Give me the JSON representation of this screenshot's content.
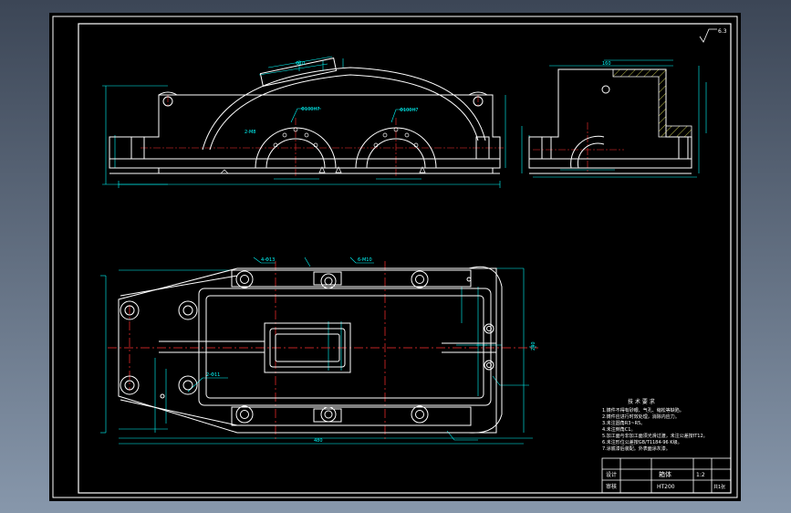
{
  "colors": {
    "background_top": "#3c4656",
    "background_bottom": "#8797ab",
    "paper": "#000000",
    "frame": "#ffffff",
    "outline": "#ffffff",
    "dimension": "#00ffff",
    "centerline": "#ff3030",
    "hatch": "#b8b84a",
    "leader": "#00ffff"
  },
  "drawing": {
    "roughness_mark": "6.3",
    "notes_heading": "技 术 要 求",
    "notes": [
      "1.铸件不得有砂眼、气孔、缩松等缺陷。",
      "2.铸件应进行时效处理，消除内应力。",
      "3.未注圆角R3~R5。",
      "4.未注倒角C1。",
      "5.加工面与非加工面须光滑过渡，未注公差按IT12。",
      "6.未注形位公差按GB/T1184-96 K级。",
      "7.涂底漆后装配。外表面涂灰漆。"
    ],
    "title_block": {
      "name": "箱体",
      "material": "HT200",
      "scale": "1:2",
      "row_labels": [
        "设计",
        "审核"
      ],
      "sheet": "共1张"
    },
    "dim_labels": {
      "cap_top": "Φ10",
      "left_tap": "2-M8",
      "bearing_left": "Φ100H7",
      "bearing_right": "Φ100H7",
      "top_view_callout_1": "4-Φ13",
      "top_view_callout_2": "6-M10",
      "side_top": "160",
      "plan_bottom": "480",
      "plan_height": "240",
      "plan_hole": "2-Φ11"
    }
  }
}
